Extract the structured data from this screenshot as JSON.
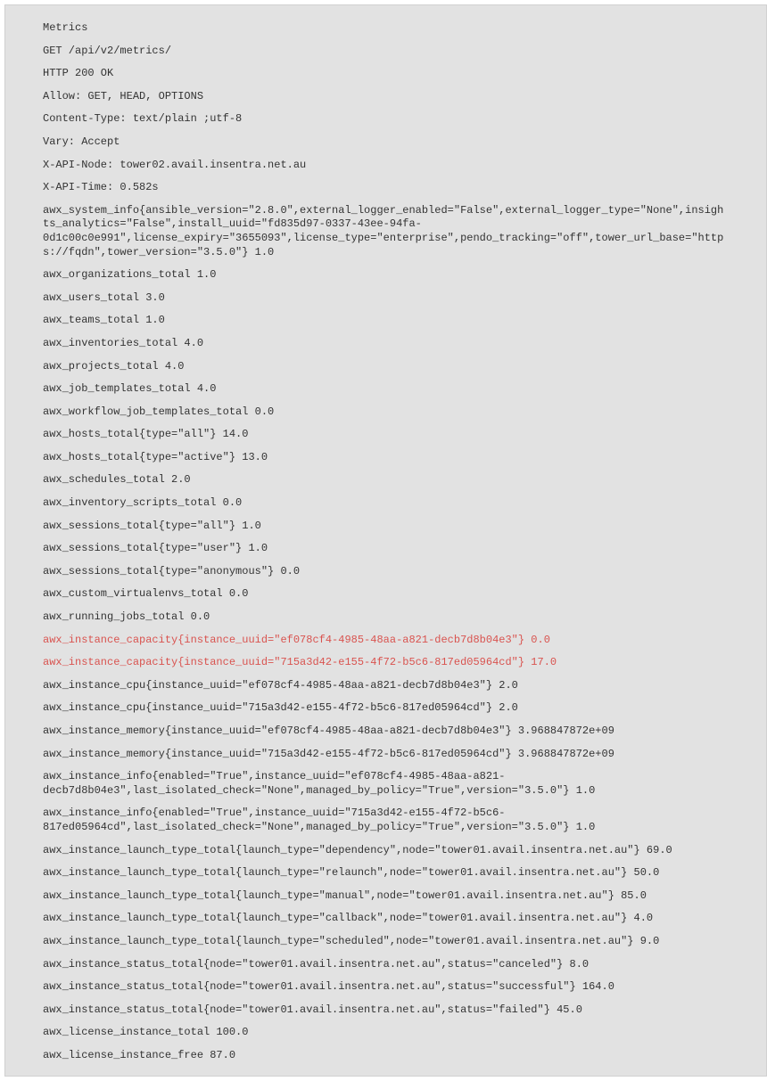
{
  "lines": [
    {
      "text": "Metrics",
      "highlight": false
    },
    {
      "text": "GET /api/v2/metrics/",
      "highlight": false
    },
    {
      "text": "HTTP 200 OK",
      "highlight": false
    },
    {
      "text": "Allow: GET, HEAD, OPTIONS",
      "highlight": false
    },
    {
      "text": "Content-Type: text/plain ;utf-8",
      "highlight": false
    },
    {
      "text": "Vary: Accept",
      "highlight": false
    },
    {
      "text": "X-API-Node: tower02.avail.insentra.net.au",
      "highlight": false
    },
    {
      "text": "X-API-Time: 0.582s",
      "highlight": false
    },
    {
      "text": "awx_system_info{ansible_version=\"2.8.0\",external_logger_enabled=\"False\",external_logger_type=\"None\",insights_analytics=\"False\",install_uuid=\"fd835d97-0337-43ee-94fa-0d1c00c0e991\",license_expiry=\"3655093\",license_type=\"enterprise\",pendo_tracking=\"off\",tower_url_base=\"https://fqdn\",tower_version=\"3.5.0\"} 1.0",
      "highlight": false
    },
    {
      "text": "awx_organizations_total 1.0",
      "highlight": false
    },
    {
      "text": "awx_users_total 3.0",
      "highlight": false
    },
    {
      "text": "awx_teams_total 1.0",
      "highlight": false
    },
    {
      "text": "awx_inventories_total 4.0",
      "highlight": false
    },
    {
      "text": "awx_projects_total 4.0",
      "highlight": false
    },
    {
      "text": "awx_job_templates_total 4.0",
      "highlight": false
    },
    {
      "text": "awx_workflow_job_templates_total 0.0",
      "highlight": false
    },
    {
      "text": "awx_hosts_total{type=\"all\"} 14.0",
      "highlight": false
    },
    {
      "text": "awx_hosts_total{type=\"active\"} 13.0",
      "highlight": false
    },
    {
      "text": "awx_schedules_total 2.0",
      "highlight": false
    },
    {
      "text": "awx_inventory_scripts_total 0.0",
      "highlight": false
    },
    {
      "text": "awx_sessions_total{type=\"all\"} 1.0",
      "highlight": false
    },
    {
      "text": "awx_sessions_total{type=\"user\"} 1.0",
      "highlight": false
    },
    {
      "text": "awx_sessions_total{type=\"anonymous\"} 0.0",
      "highlight": false
    },
    {
      "text": "awx_custom_virtualenvs_total 0.0",
      "highlight": false
    },
    {
      "text": "awx_running_jobs_total 0.0",
      "highlight": false
    },
    {
      "text": "awx_instance_capacity{instance_uuid=\"ef078cf4-4985-48aa-a821-decb7d8b04e3\"} 0.0",
      "highlight": true
    },
    {
      "text": "awx_instance_capacity{instance_uuid=\"715a3d42-e155-4f72-b5c6-817ed05964cd\"} 17.0",
      "highlight": true
    },
    {
      "text": "awx_instance_cpu{instance_uuid=\"ef078cf4-4985-48aa-a821-decb7d8b04e3\"} 2.0",
      "highlight": false
    },
    {
      "text": "awx_instance_cpu{instance_uuid=\"715a3d42-e155-4f72-b5c6-817ed05964cd\"} 2.0",
      "highlight": false
    },
    {
      "text": "awx_instance_memory{instance_uuid=\"ef078cf4-4985-48aa-a821-decb7d8b04e3\"} 3.968847872e+09",
      "highlight": false
    },
    {
      "text": "awx_instance_memory{instance_uuid=\"715a3d42-e155-4f72-b5c6-817ed05964cd\"} 3.968847872e+09",
      "highlight": false
    },
    {
      "text": "awx_instance_info{enabled=\"True\",instance_uuid=\"ef078cf4-4985-48aa-a821-decb7d8b04e3\",last_isolated_check=\"None\",managed_by_policy=\"True\",version=\"3.5.0\"} 1.0",
      "highlight": false
    },
    {
      "text": "awx_instance_info{enabled=\"True\",instance_uuid=\"715a3d42-e155-4f72-b5c6-817ed05964cd\",last_isolated_check=\"None\",managed_by_policy=\"True\",version=\"3.5.0\"} 1.0",
      "highlight": false
    },
    {
      "text": "awx_instance_launch_type_total{launch_type=\"dependency\",node=\"tower01.avail.insentra.net.au\"} 69.0",
      "highlight": false
    },
    {
      "text": "awx_instance_launch_type_total{launch_type=\"relaunch\",node=\"tower01.avail.insentra.net.au\"} 50.0",
      "highlight": false
    },
    {
      "text": "awx_instance_launch_type_total{launch_type=\"manual\",node=\"tower01.avail.insentra.net.au\"} 85.0",
      "highlight": false
    },
    {
      "text": "awx_instance_launch_type_total{launch_type=\"callback\",node=\"tower01.avail.insentra.net.au\"} 4.0",
      "highlight": false
    },
    {
      "text": "awx_instance_launch_type_total{launch_type=\"scheduled\",node=\"tower01.avail.insentra.net.au\"} 9.0",
      "highlight": false
    },
    {
      "text": "awx_instance_status_total{node=\"tower01.avail.insentra.net.au\",status=\"canceled\"} 8.0",
      "highlight": false
    },
    {
      "text": "awx_instance_status_total{node=\"tower01.avail.insentra.net.au\",status=\"successful\"} 164.0",
      "highlight": false
    },
    {
      "text": "awx_instance_status_total{node=\"tower01.avail.insentra.net.au\",status=\"failed\"} 45.0",
      "highlight": false
    },
    {
      "text": "awx_license_instance_total 100.0",
      "highlight": false
    },
    {
      "text": "awx_license_instance_free 87.0",
      "highlight": false
    }
  ]
}
